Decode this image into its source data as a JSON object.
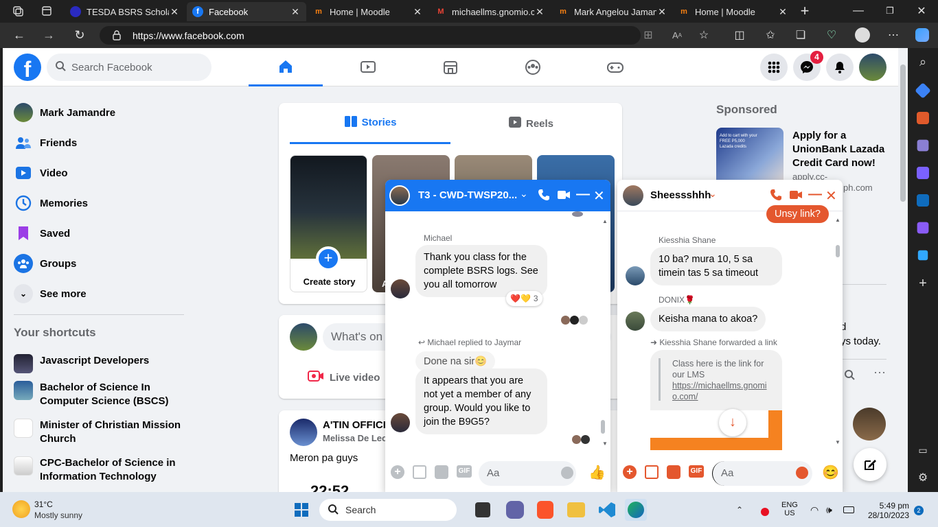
{
  "tabs": [
    {
      "title": "TESDA BSRS Scholar",
      "fav_color": "#2a2ac0"
    },
    {
      "title": "Facebook",
      "fav_color": "#1877f2"
    },
    {
      "title": "Home | Moodle",
      "fav_color": "#f98012"
    },
    {
      "title": "michaellms.gnomio.c",
      "fav_color": "#ea4335"
    },
    {
      "title": "Mark Angelou Jaman",
      "fav_color": "#f98012"
    },
    {
      "title": "Home | Moodle",
      "fav_color": "#f98012"
    }
  ],
  "url": "https://www.facebook.com",
  "fb": {
    "search_placeholder": "Search Facebook",
    "messenger_badge": "4"
  },
  "left_nav": [
    {
      "label": "Mark Jamandre"
    },
    {
      "label": "Friends"
    },
    {
      "label": "Video"
    },
    {
      "label": "Memories"
    },
    {
      "label": "Saved"
    },
    {
      "label": "Groups"
    },
    {
      "label": "See more"
    }
  ],
  "shortcuts_title": "Your shortcuts",
  "shortcuts": [
    {
      "label": "Javascript Developers"
    },
    {
      "label": "Bachelor of Science In Computer Science (BSCS)"
    },
    {
      "label": "Minister of Christian Mission Church"
    },
    {
      "label": "CPC-Bachelor of Science in Information Technology"
    }
  ],
  "stories": {
    "tab_stories": "Stories",
    "tab_reels": "Reels",
    "create_story": "Create story",
    "story_letter": "A"
  },
  "composer": {
    "placeholder": "What's on",
    "live_video": "Live video"
  },
  "post": {
    "author": "A'TIN OFFICIA",
    "sub": "Melissa De Leon",
    "text": "Meron pa guys",
    "clock": "22:52"
  },
  "sponsored": {
    "title": "Sponsored",
    "ad_title": "Apply for a UnionBank Lazada Credit Card now!",
    "ad_domain": "apply.cc-",
    "ad_domain2": "ph.com",
    "ad_img_text": "Add to cart with your FREE P5,000 Lazada credits",
    "snip1": "d",
    "snip2": "ys today."
  },
  "chat1": {
    "title": "T3 - CWD-TWSP20...",
    "sender1": "Michael",
    "msg1": "Thank you class for the complete BSRS logs.  See you all tomorrow",
    "react_count": "3",
    "reply_label": "Michael replied to Jaymar",
    "quoted": "Done na sir😊",
    "msg2": "It appears that you are not yet a member of any group.  Would you like to join the B9G5?",
    "input_placeholder": "Aa",
    "gif": "GIF"
  },
  "chat2": {
    "title": "Sheessshhh",
    "top_bubble": "Unsy link?",
    "sender1": "Kiesshia Shane",
    "msg1": "10 ba? mura 10, 5 sa timein tas 5 sa timeout",
    "sender2": "DONIX🌹",
    "msg2": "Keisha mana to akoa?",
    "fwd_label": "Kiesshia Shane forwarded a link",
    "fwd_text": "Class here is the link for our LMS",
    "fwd_link": "https://michaellms.gnomio.com/",
    "input_placeholder": "Aa",
    "gif": "GIF"
  },
  "taskbar": {
    "temp": "31°C",
    "weather": "Mostly sunny",
    "search": "Search",
    "lang1": "ENG",
    "lang2": "US",
    "time": "5:49 pm",
    "date": "28/10/2023",
    "notif": "2"
  }
}
